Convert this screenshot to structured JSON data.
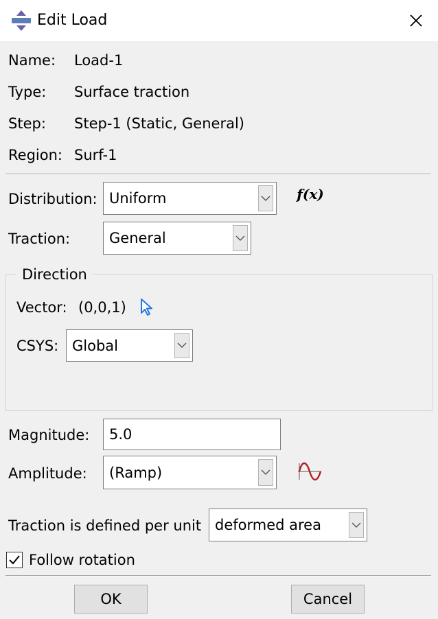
{
  "window": {
    "title": "Edit Load",
    "icon": "load-icon",
    "close_icon": "close-icon"
  },
  "info": {
    "name_label": "Name:",
    "name_value": "Load-1",
    "type_label": "Type:",
    "type_value": "Surface traction",
    "step_label": "Step:",
    "step_value": "Step-1 (Static, General)",
    "region_label": "Region:",
    "region_value": "Surf-1"
  },
  "distribution": {
    "label": "Distribution:",
    "value": "Uniform",
    "function_button": "f(x)"
  },
  "traction": {
    "label": "Traction:",
    "value": "General"
  },
  "direction": {
    "legend": "Direction",
    "vector_label": "Vector:",
    "vector_value": "(0,0,1)",
    "picker_icon": "cursor-arrow-icon",
    "csys_label": "CSYS:",
    "csys_value": "Global"
  },
  "magnitude": {
    "label": "Magnitude:",
    "value": "5.0"
  },
  "amplitude": {
    "label": "Amplitude:",
    "value": "(Ramp)",
    "icon": "amplitude-wave-icon"
  },
  "per_unit": {
    "label": "Traction is defined per unit",
    "value": "deformed area"
  },
  "follow_rotation": {
    "label": "Follow rotation",
    "checked": true
  },
  "buttons": {
    "ok": "OK",
    "cancel": "Cancel"
  },
  "colors": {
    "titlebar": "#ffffff",
    "dialog_bg": "#f0f0f0",
    "picker_blue": "#1e78e6",
    "wave_red": "#b41e1e"
  }
}
